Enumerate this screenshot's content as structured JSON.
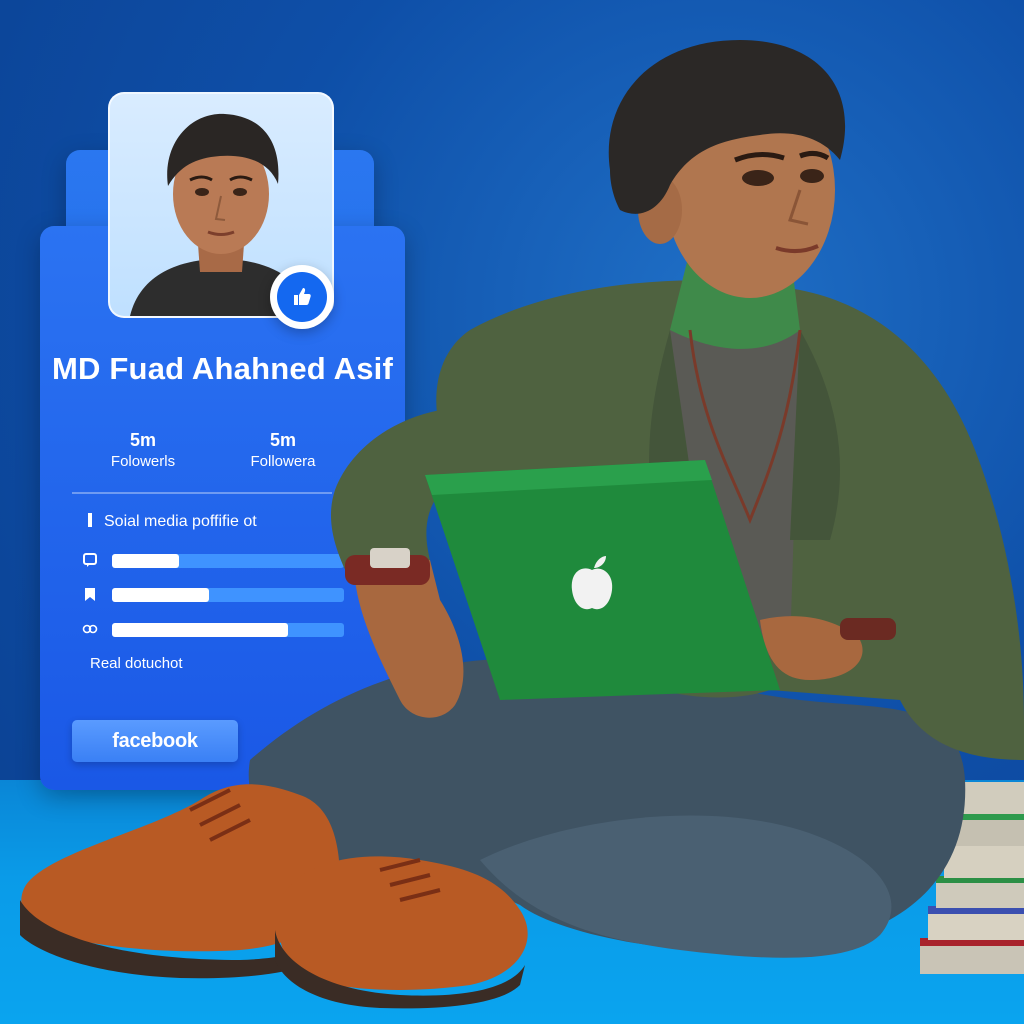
{
  "profile": {
    "name": "MD Fuad Ahahned Asif",
    "stats": [
      {
        "value": "5m",
        "label": "Folowerls"
      },
      {
        "value": "5m",
        "label": "Followera"
      }
    ],
    "section_title": "Soial media poffifie ot",
    "progress_bars": [
      {
        "icon": "chat-icon",
        "fraction": 0.29
      },
      {
        "icon": "bookmark-icon",
        "fraction": 0.42
      },
      {
        "icon": "share-icon",
        "fraction": 0.76
      }
    ],
    "footer_text": "Real dotuchot",
    "button_label": "facebook"
  },
  "colors": {
    "background": "#0e4fa8",
    "card": "#1a5fe0",
    "accent": "#1468f0",
    "laptop": "#1f8a3c",
    "jacket": "#4f6240",
    "shoes": "#b85a24"
  },
  "icons": [
    "thumbs-up-icon",
    "apple-logo-icon",
    "chat-icon",
    "bookmark-icon",
    "share-icon"
  ]
}
